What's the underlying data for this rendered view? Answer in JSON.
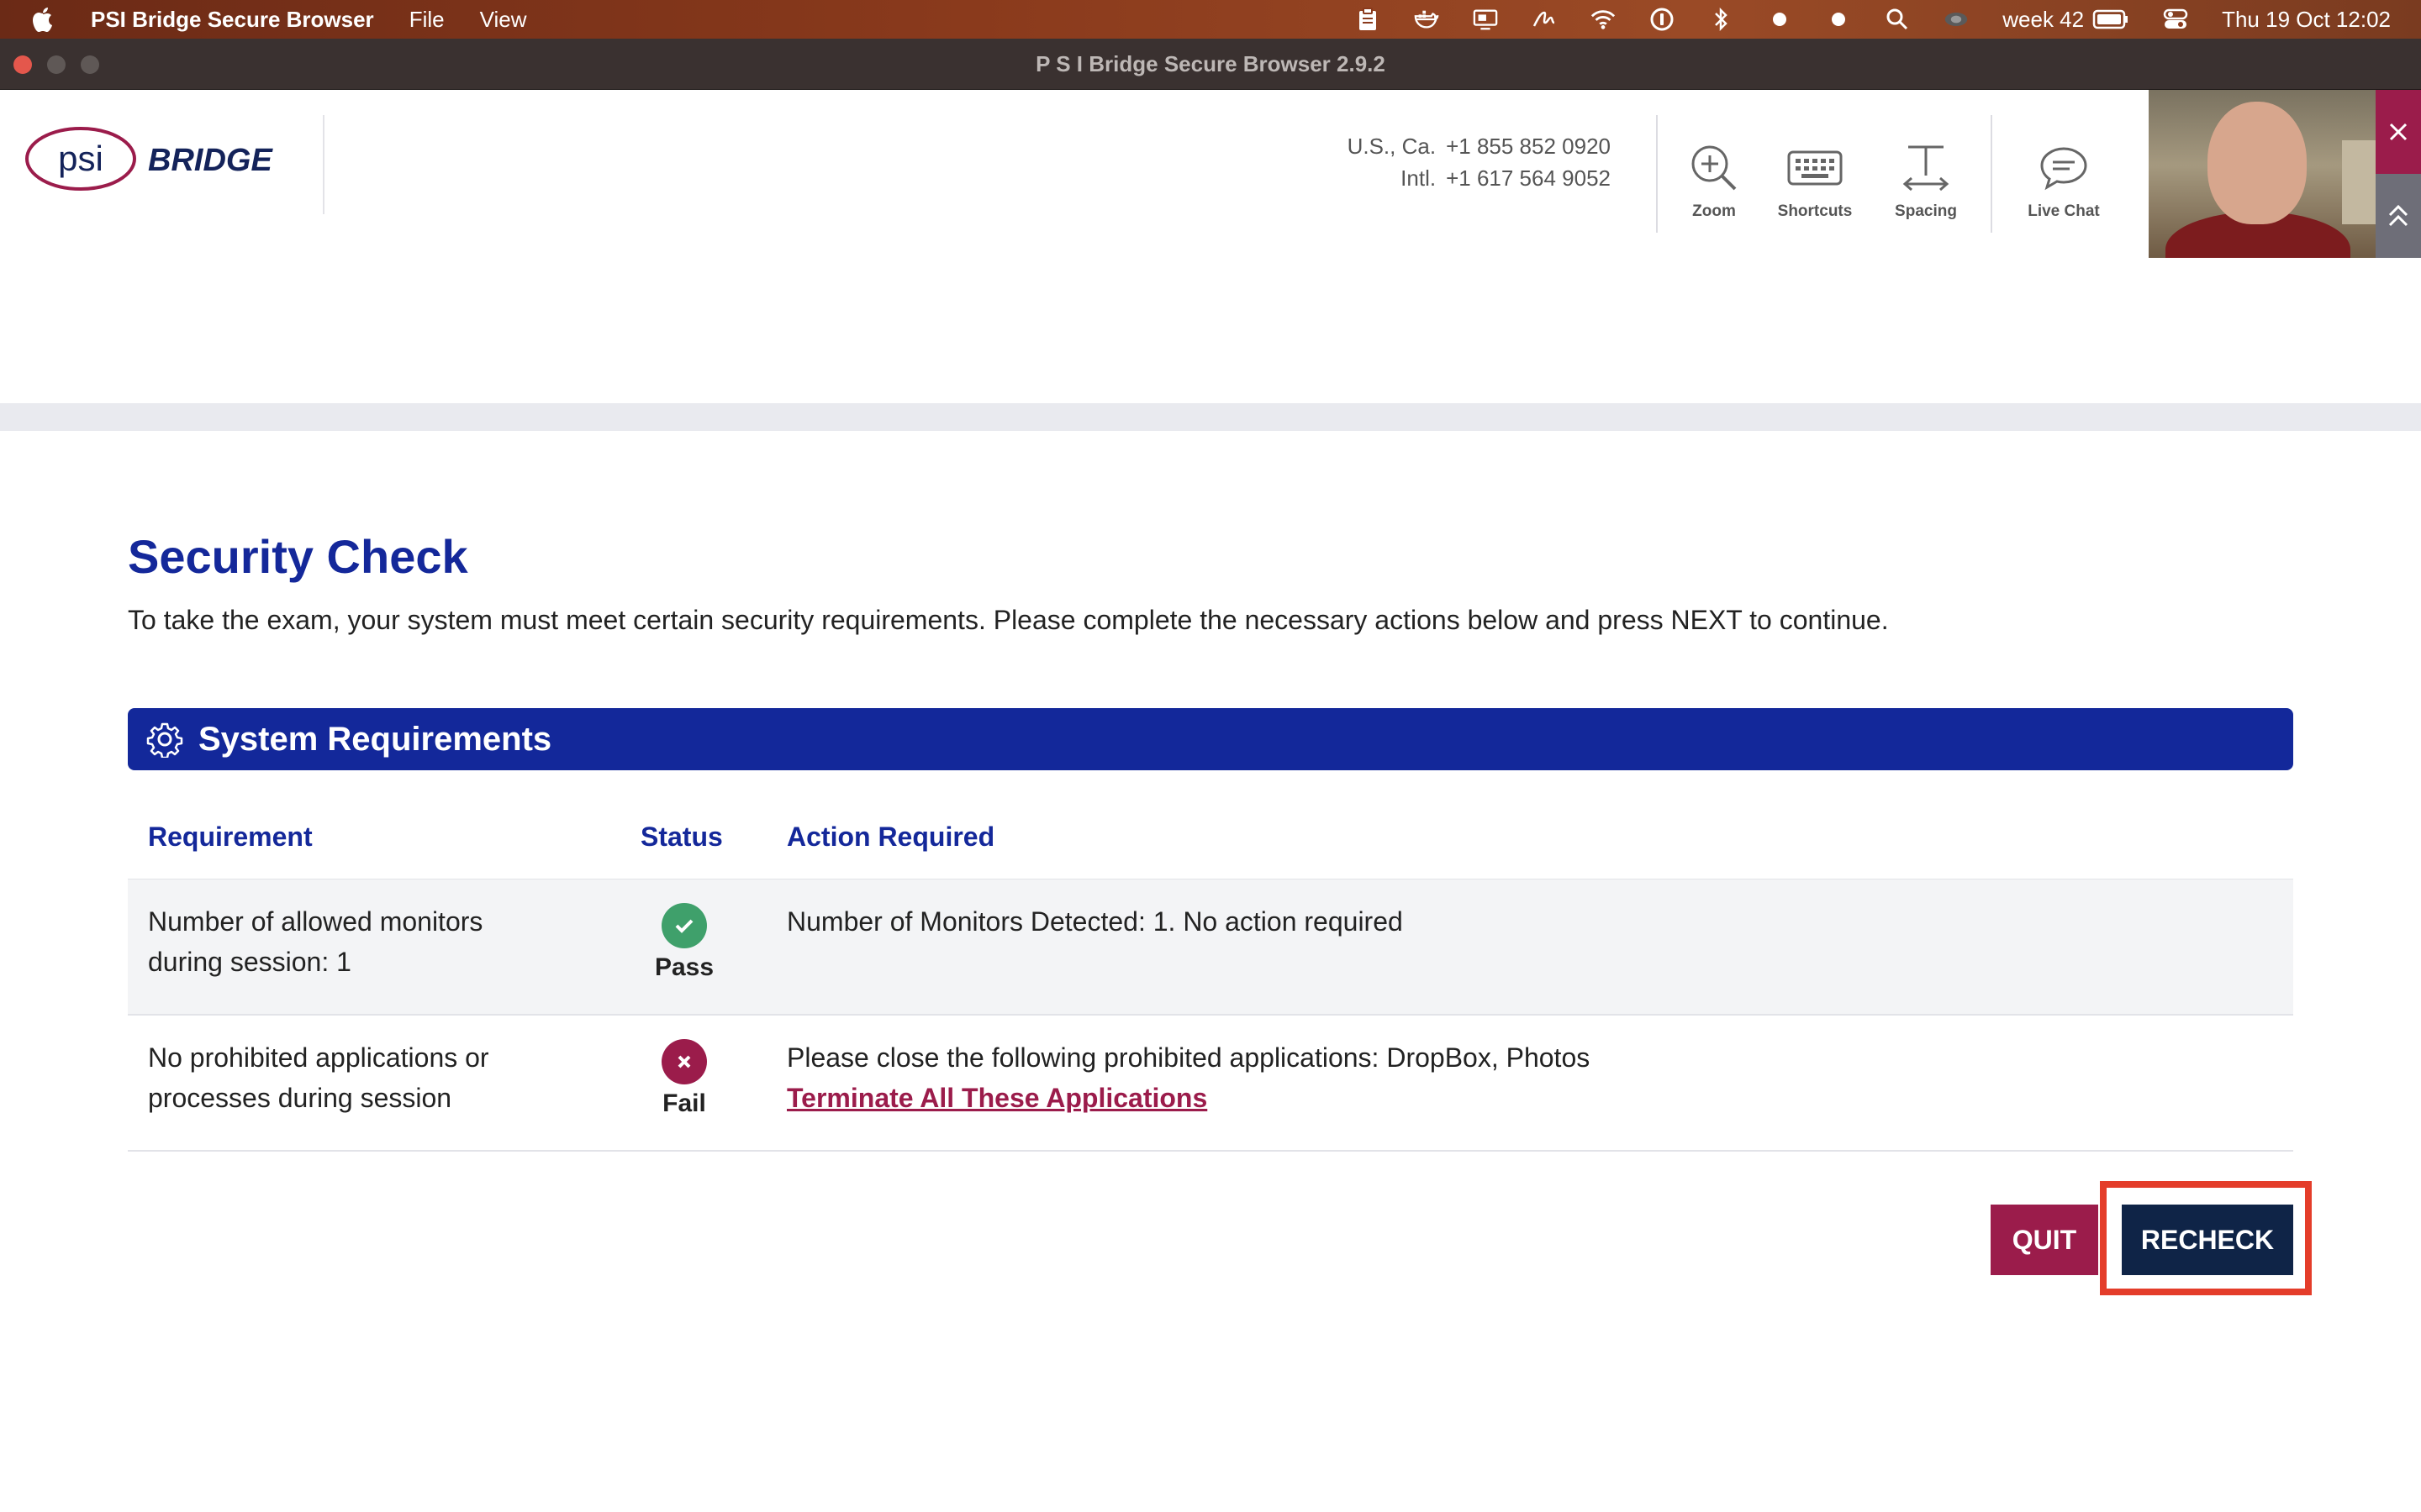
{
  "menubar": {
    "app_name": "PSI Bridge Secure Browser",
    "menus": [
      "File",
      "View"
    ],
    "week": "week 42",
    "datetime": "Thu 19 Oct  12:02"
  },
  "window": {
    "title": "P S I Bridge Secure Browser 2.9.2"
  },
  "header": {
    "logo_text": "psi",
    "brand_text": "BRIDGE",
    "phone_us_label": "U.S., Ca.",
    "phone_us": "+1 855 852 0920",
    "phone_intl_label": "Intl.",
    "phone_intl": "+1 617 564 9052",
    "tools": [
      {
        "label": "Zoom",
        "icon": "zoom-in-icon"
      },
      {
        "label": "Shortcuts",
        "icon": "keyboard-icon"
      },
      {
        "label": "Spacing",
        "icon": "spacing-icon"
      },
      {
        "label": "Live Chat",
        "icon": "chat-icon"
      }
    ]
  },
  "main": {
    "title": "Security Check",
    "intro": "To take the exam, your system must meet certain security requirements. Please complete the necessary actions below and press NEXT to continue.",
    "section_title": "System Requirements",
    "columns": [
      "Requirement",
      "Status",
      "Action Required"
    ],
    "rows": [
      {
        "requirement": "Number of allowed monitors during session: 1",
        "status": "Pass",
        "action": "Number of Monitors Detected: 1. No action required",
        "link": ""
      },
      {
        "requirement": "No prohibited applications or processes during session",
        "status": "Fail",
        "action": "Please close the following prohibited applications: DropBox, Photos",
        "link": "Terminate All These Applications"
      }
    ],
    "quit_label": "QUIT",
    "recheck_label": "RECHECK"
  },
  "colors": {
    "primary": "#13289a",
    "accent": "#9b1c4b",
    "pass": "#3fa06b",
    "recheck": "#0f2447",
    "highlight": "#e43d2a"
  }
}
